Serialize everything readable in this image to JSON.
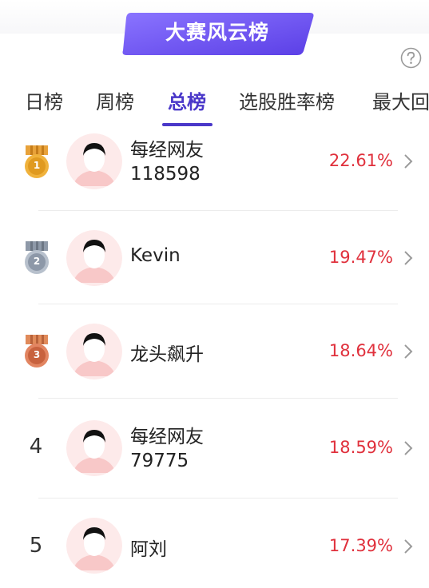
{
  "banner": {
    "title": "大赛风云榜"
  },
  "tabs": [
    {
      "label": "日榜",
      "active": false
    },
    {
      "label": "周榜",
      "active": false
    },
    {
      "label": "总榜",
      "active": true
    },
    {
      "label": "选股胜率榜",
      "active": false
    },
    {
      "label": "最大回",
      "active": false
    }
  ],
  "colors": {
    "accent": "#4a38c9",
    "rate": "#e0303c",
    "banner": "#6a4ef0"
  },
  "leaderboard": [
    {
      "rank": "1",
      "badge": "gold-medal-icon",
      "name_line1": "每经网友",
      "name_line2": "118598",
      "rate": "22.61%"
    },
    {
      "rank": "2",
      "badge": "silver-medal-icon",
      "name_line1": "Kevin",
      "name_line2": "",
      "rate": "19.47%"
    },
    {
      "rank": "3",
      "badge": "bronze-medal-icon",
      "name_line1": "龙头飙升",
      "name_line2": "",
      "rate": "18.64%"
    },
    {
      "rank": "4",
      "badge": "",
      "name_line1": "每经网友",
      "name_line2": "79775",
      "rate": "18.59%"
    },
    {
      "rank": "5",
      "badge": "",
      "name_line1": "阿刘",
      "name_line2": "",
      "rate": "17.39%"
    }
  ]
}
